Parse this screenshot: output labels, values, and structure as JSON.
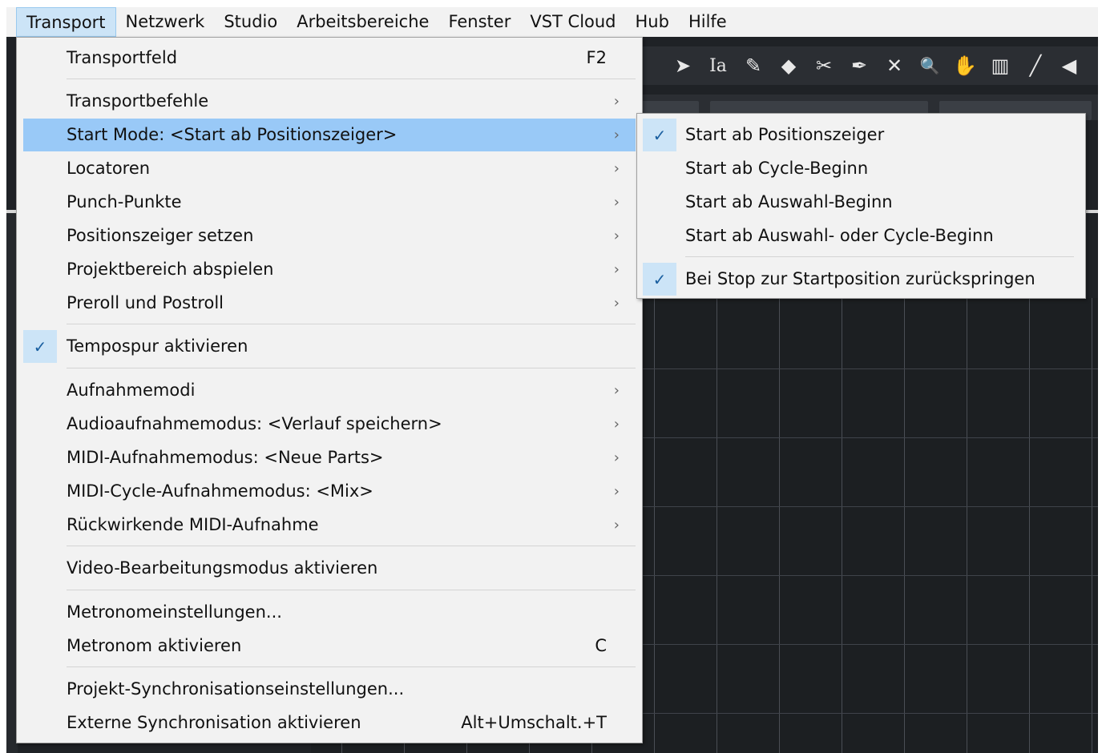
{
  "menubar": {
    "items": [
      "Transport",
      "Netzwerk",
      "Studio",
      "Arbeitsbereiche",
      "Fenster",
      "VST Cloud",
      "Hub",
      "Hilfe"
    ]
  },
  "transport_menu": {
    "items": [
      {
        "label": "Transportfeld",
        "shortcut": "F2"
      },
      {
        "label": "Transportbefehle",
        "arrow": "›"
      },
      {
        "label": "Start Mode: <Start ab Positionszeiger>",
        "arrow": "›"
      },
      {
        "label": "Locatoren",
        "arrow": "›"
      },
      {
        "label": "Punch-Punkte",
        "arrow": "›"
      },
      {
        "label": "Positionszeiger setzen",
        "arrow": "›"
      },
      {
        "label": "Projektbereich abspielen",
        "arrow": "›"
      },
      {
        "label": "Preroll und Postroll",
        "arrow": "›"
      },
      {
        "label": "Tempospur aktivieren",
        "checked": true
      },
      {
        "label": "Aufnahmemodi",
        "arrow": "›"
      },
      {
        "label": "Audioaufnahmemodus: <Verlauf speichern>",
        "arrow": "›"
      },
      {
        "label": "MIDI-Aufnahmemodus: <Neue Parts>",
        "arrow": "›"
      },
      {
        "label": "MIDI-Cycle-Aufnahmemodus: <Mix>",
        "arrow": "›"
      },
      {
        "label": "Rückwirkende MIDI-Aufnahme",
        "arrow": "›"
      },
      {
        "label": "Video-Bearbeitungsmodus aktivieren"
      },
      {
        "label": "Metronomeinstellungen..."
      },
      {
        "label": "Metronom aktivieren",
        "shortcut": "C"
      },
      {
        "label": "Projekt-Synchronisationseinstellungen..."
      },
      {
        "label": "Externe Synchronisation aktivieren",
        "shortcut": "Alt+Umschalt.+T"
      }
    ],
    "check_glyph": "✓"
  },
  "start_mode_submenu": {
    "items": [
      {
        "label": "Start ab Positionszeiger",
        "checked": true
      },
      {
        "label": "Start ab Cycle-Beginn"
      },
      {
        "label": "Start ab Auswahl-Beginn"
      },
      {
        "label": "Start ab Auswahl- oder Cycle-Beginn"
      },
      {
        "label": "Bei Stop zur Startposition zurückspringen",
        "checked": true
      }
    ]
  },
  "toolbar": {
    "tools": [
      "object-select-icon",
      "text-icon",
      "draw-pencil-icon",
      "erase-icon",
      "split-scissors-icon",
      "glue-icon",
      "mute-x-icon",
      "zoom-icon",
      "hand-icon",
      "comp-icon",
      "line-icon",
      "speaker-icon"
    ],
    "glyphs": [
      "➤",
      "Ia",
      "✎",
      "◆",
      "✂",
      "✒",
      "✕",
      "🔍",
      "✋",
      "▥",
      "╱",
      "◀"
    ]
  },
  "colors": {
    "menu_bg": "#f2f2f2",
    "highlight": "#99c9f7",
    "check_bg": "#cce4f7",
    "daw_bg": "#1f2226"
  }
}
